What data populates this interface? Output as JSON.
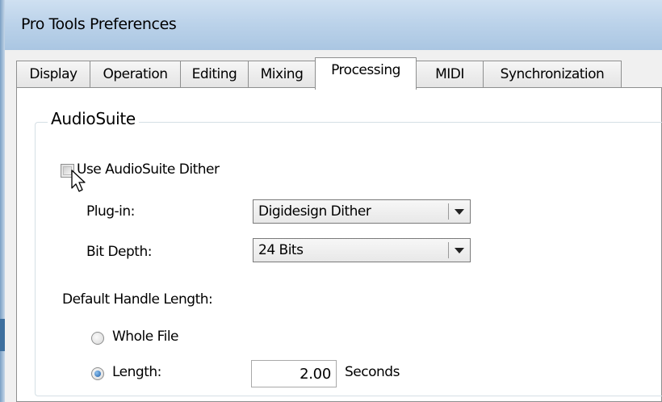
{
  "window": {
    "title": "Pro Tools Preferences"
  },
  "tabs": [
    {
      "label": "Display"
    },
    {
      "label": "Operation"
    },
    {
      "label": "Editing"
    },
    {
      "label": "Mixing"
    },
    {
      "label": "Processing",
      "active": true
    },
    {
      "label": "MIDI"
    },
    {
      "label": "Synchronization"
    }
  ],
  "audiosuite": {
    "group_title": "AudioSuite",
    "dither_checkbox_label": "Use AudioSuite Dither",
    "dither_checked": false,
    "plugin_label": "Plug-in:",
    "plugin_value": "Digidesign Dither",
    "bitdepth_label": "Bit Depth:",
    "bitdepth_value": "24 Bits",
    "handle_length_label": "Default Handle Length:",
    "whole_file_label": "Whole File",
    "length_label": "Length:",
    "length_value": "2.00",
    "length_unit": "Seconds",
    "selected_option": "Length"
  }
}
